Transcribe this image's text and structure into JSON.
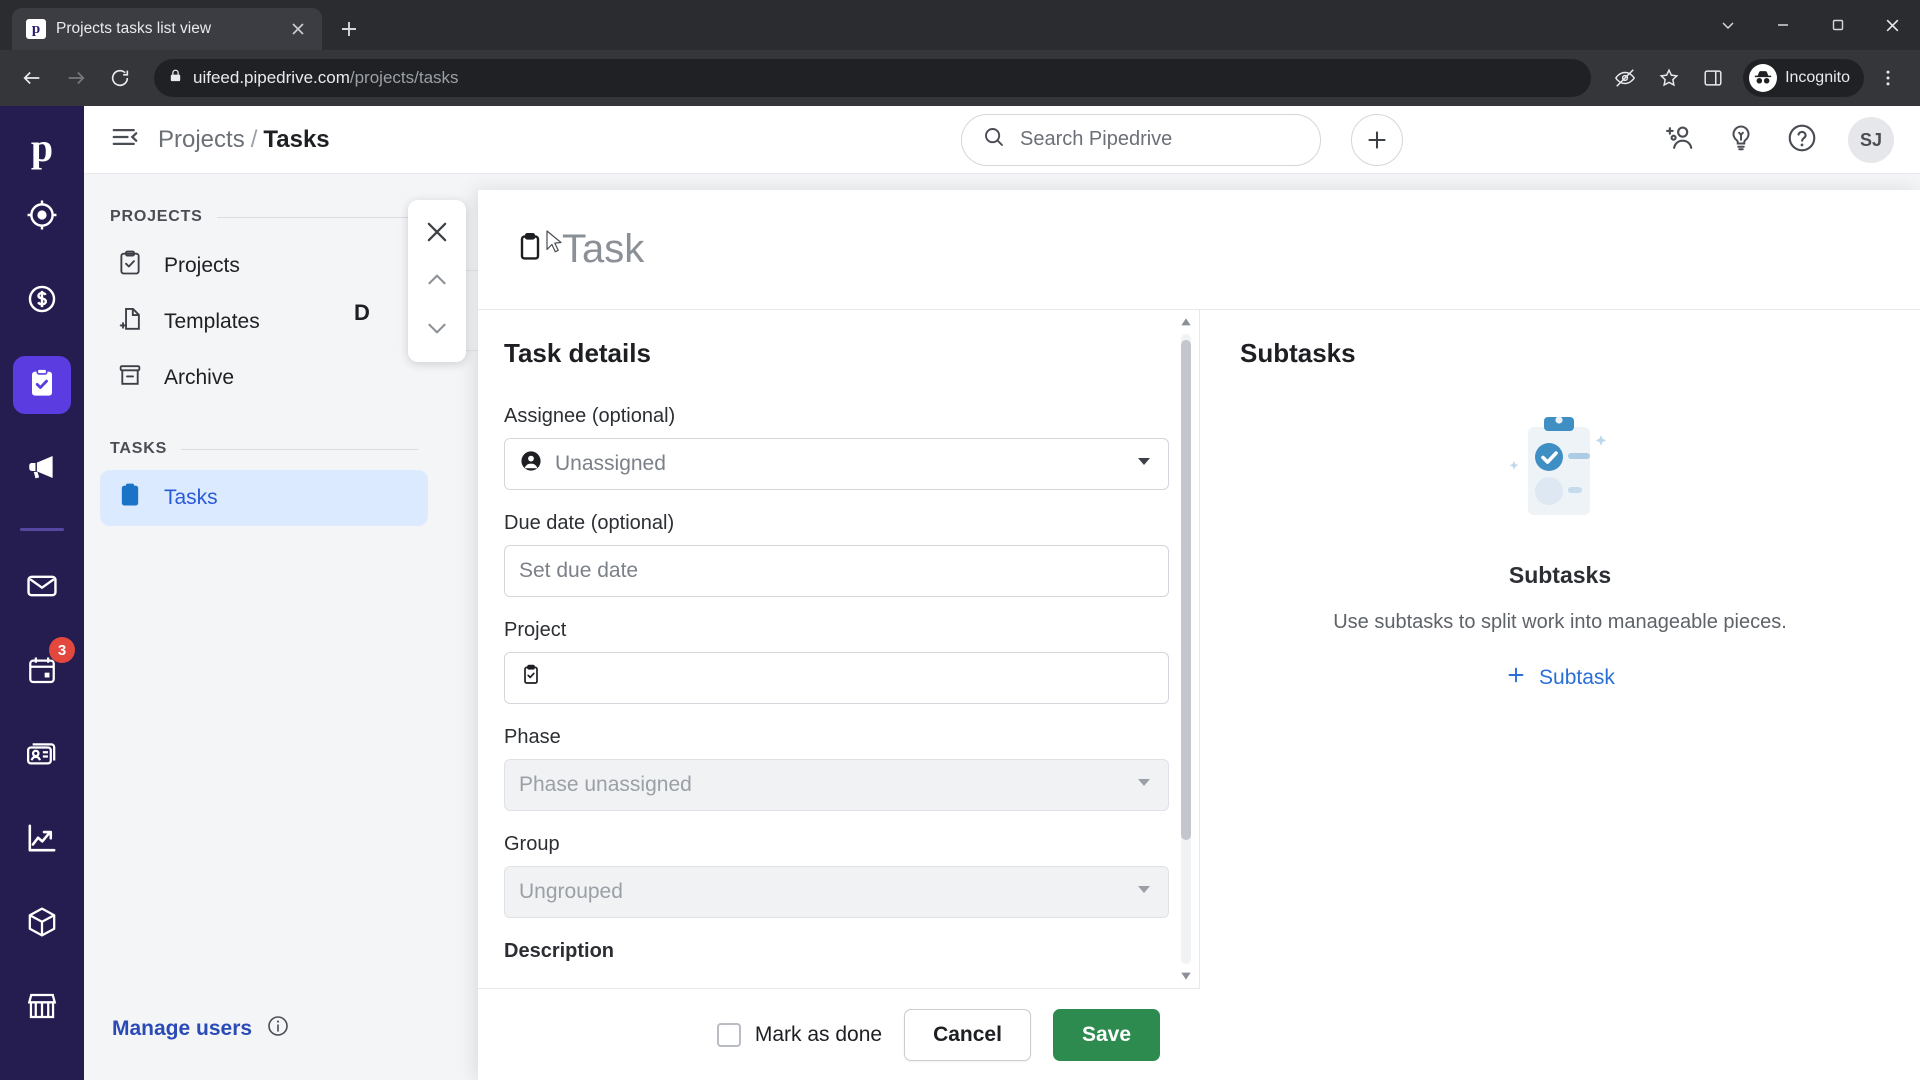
{
  "browser": {
    "tab": {
      "title": "Projects tasks list view",
      "favicon_letter": "p"
    },
    "new_tab_label": "+",
    "url": {
      "host": "uifeed.pipedrive.com",
      "path": "/projects/tasks"
    },
    "profile_label": "Incognito"
  },
  "rail": {
    "logo": "p",
    "items": [
      {
        "name": "leads-icon"
      },
      {
        "name": "deals-icon"
      },
      {
        "name": "projects-icon",
        "active": true
      },
      {
        "name": "campaigns-icon"
      },
      {
        "name": "mail-icon"
      },
      {
        "name": "calendar-icon",
        "badge": "3"
      },
      {
        "name": "contacts-icon"
      },
      {
        "name": "insights-icon"
      },
      {
        "name": "products-icon"
      },
      {
        "name": "marketplace-icon"
      }
    ]
  },
  "sidebar": {
    "breadcrumb": {
      "parent": "Projects",
      "separator": "/",
      "current": "Tasks"
    },
    "sections": [
      {
        "label": "PROJECTS",
        "items": [
          {
            "label": "Projects",
            "icon": "clipboard-check-icon"
          },
          {
            "label": "Templates",
            "icon": "file-plus-icon"
          },
          {
            "label": "Archive",
            "icon": "archive-icon"
          }
        ]
      },
      {
        "label": "TASKS",
        "items": [
          {
            "label": "Tasks",
            "icon": "clipboard-filled-icon",
            "active": true
          }
        ]
      }
    ],
    "manage_users": "Manage users"
  },
  "topbar": {
    "search_placeholder": "Search Pipedrive",
    "add_label": "+",
    "avatar_initials": "SJ"
  },
  "workspace": {
    "column_header": "D"
  },
  "nav_float": {
    "close_label": "close-icon",
    "prev_label": "chevron-up-icon",
    "next_label": "chevron-down-icon"
  },
  "modal": {
    "title": "Task",
    "form": {
      "section_title": "Task details",
      "fields": [
        {
          "label": "Assignee (optional)",
          "value": "Unassigned",
          "icon": "user-circle-icon",
          "type": "select",
          "disabled": false
        },
        {
          "label": "Due date (optional)",
          "value": "Set due date",
          "icon": "",
          "type": "text",
          "disabled": false
        },
        {
          "label": "Project",
          "value": "",
          "icon": "clipboard-check-icon",
          "type": "text",
          "disabled": false
        },
        {
          "label": "Phase",
          "value": "Phase unassigned",
          "icon": "",
          "type": "select",
          "disabled": true
        },
        {
          "label": "Group",
          "value": "Ungrouped",
          "icon": "",
          "type": "select",
          "disabled": true
        }
      ],
      "description_label": "Description"
    },
    "subtasks": {
      "title": "Subtasks",
      "empty_heading": "Subtasks",
      "empty_desc": "Use subtasks to split work into manageable pieces.",
      "add_label": "Subtask",
      "add_plus": "+"
    },
    "footer": {
      "mark_done_label": "Mark as done",
      "cancel_label": "Cancel",
      "save_label": "Save"
    }
  },
  "colors": {
    "rail_bg": "#251d4f",
    "rail_active": "#5b3ce0",
    "accent_blue": "#2a5bd7",
    "save_green": "#2e8b4f",
    "badge_red": "#e2483d"
  }
}
